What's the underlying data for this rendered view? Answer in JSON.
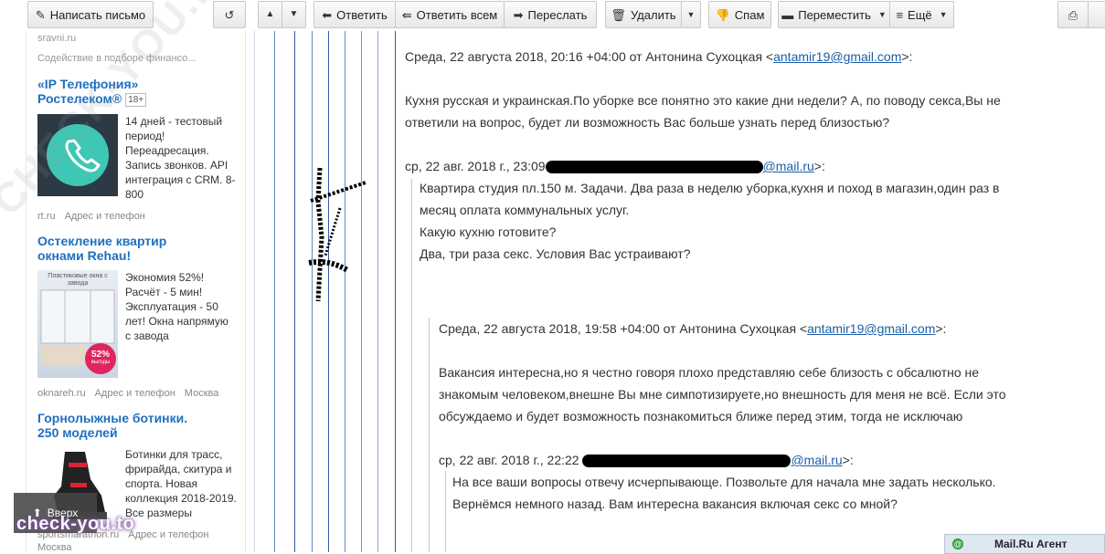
{
  "toolbar": {
    "compose": "Написать письмо",
    "reply": "Ответить",
    "reply_all": "Ответить всем",
    "forward": "Переслать",
    "delete": "Удалить",
    "spam": "Спам",
    "move": "Переместить",
    "more": "Ещё"
  },
  "sidebar": {
    "top_source": "sravni.ru",
    "top_desc": "Содействие в подборе финансо...",
    "ads": [
      {
        "title_line1": "«IP Телефония»",
        "title_line2": "Ростелеком®",
        "age": "18+",
        "text": "14 дней - тестовый период! Переадресация. Запись звонков. API интеграция с CRM. 8-800",
        "source": "rt.ru",
        "link": "Адрес и телефон",
        "city": ""
      },
      {
        "title_line1": "Остекление квартир",
        "title_line2": "окнами Rehau!",
        "text": "Экономия 52%! Расчёт - 5 мин! Эксплуатация - 50 лет! Окна напрямую с завода",
        "img_caption": "Пластиковые окна с завода",
        "badge_pct": "52%",
        "badge_word": "выгоды",
        "source": "oknareh.ru",
        "link": "Адрес и телефон",
        "city": "Москва"
      },
      {
        "title_line1": "Горнолыжные ботинки.",
        "title_line2": "250 моделей",
        "text": "Ботинки для трасс, фрирайда, скитура и спорта. Новая коллекция 2018-2019. Все размеры",
        "source": "sportsmarathon.ru",
        "link": "Адрес и телефон",
        "city": "Москва"
      }
    ]
  },
  "message": {
    "h1_prefix": "Среда, 22 августа 2018, 20:16 +04:00 от Антонина Сухоцкая <",
    "h1_email": "antamir19@gmail.com",
    "h1_suffix": ">:",
    "p1_line1": "Кухня русская и украинская.По уборке все понятно это какие дни недели? А, по поводу секса,Вы не",
    "p1_line2": "ответили на вопрос, будет ли возможность Вас больше узнать перед близостью?",
    "h2_prefix": "ср, 22 авг. 2018 г., 23:09",
    "h2_email": "@mail.ru",
    "h2_suffix": ">:",
    "q1_line1": "Квартира студия пл.150 м. Задачи. Два раза в неделю уборка,кухня и поход в магазин,один раз в",
    "q1_line2": "месяц оплата коммунальных услуг.",
    "q1_line3": "Какую кухню готовите?",
    "q1_line4": "Два, три раза секс. Условия Вас устраивают?",
    "h3_prefix": "Среда, 22 августа 2018, 19:58 +04:00 от Антонина Сухоцкая <",
    "h3_email": "antamir19@gmail.com",
    "h3_suffix": ">:",
    "p2_line1": "Вакансия интересна,но я честно говоря плохо представляю себе близость с обсалютно не",
    "p2_line2": "знакомым человеком,внешне Вы мне симпотизируете,но внешность для меня не всё. Если это",
    "p2_line3": "обсуждаемо и будет возможность познакомиться ближе перед этим, тогда не исключаю",
    "h4_prefix": "ср, 22 авг. 2018 г., 22:22",
    "h4_email": "@mail.ru",
    "h4_suffix": ">:",
    "q2_line1": "На все ваши вопросы отвечу исчерпывающе. Позвольте для начала мне задать несколько.",
    "q2_line2": "Вернёмся немного назад. Вам интересна вакансия включая секс со мной?"
  },
  "overlays": {
    "up_button": "Вверх",
    "watermark_bottom": "check-you.to",
    "watermark_diagonal": "CHECK-YOU.ME",
    "agent": "Mail.Ru Агент"
  }
}
